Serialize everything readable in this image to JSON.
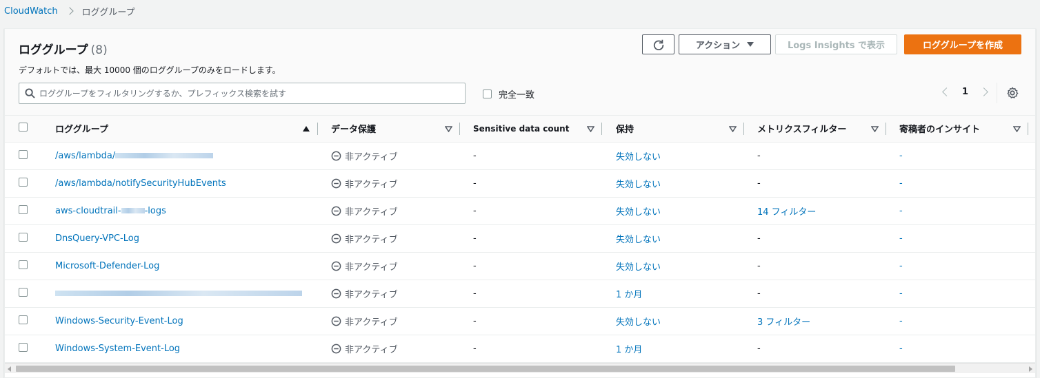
{
  "breadcrumb": {
    "root": "CloudWatch",
    "current": "ロググループ"
  },
  "header": {
    "title": "ロググループ",
    "count": "(8)",
    "description": "デフォルトでは、最大 10000 個のロググループのみをロードします。"
  },
  "toolbar": {
    "refresh_icon": "refresh-icon",
    "action_label": "アクション",
    "insights_label": "Logs Insights で表示",
    "create_label": "ロググループを作成"
  },
  "search": {
    "placeholder": "ロググループをフィルタリングするか、プレフィックス検索を試す",
    "value": ""
  },
  "exact_match_label": "完全一致",
  "pagination": {
    "current_page": "1"
  },
  "columns": {
    "log_group": "ロググループ",
    "data_protection": "データ保護",
    "sensitive_count": "Sensitive data count",
    "retention": "保持",
    "metric_filter": "メトリクスフィルター",
    "contributor_insights": "寄稿者のインサイト"
  },
  "rows": [
    {
      "name": "/aws/lambda/",
      "redacted": true,
      "protection": "非アクティブ",
      "sensitive": "-",
      "retention": "失効しない",
      "metric": "-",
      "metric_link": false,
      "insights": "-"
    },
    {
      "name": "/aws/lambda/notifySecurityHubEvents",
      "redacted": false,
      "protection": "非アクティブ",
      "sensitive": "-",
      "retention": "失効しない",
      "metric": "-",
      "metric_link": false,
      "insights": "-"
    },
    {
      "name": "aws-cloudtrail-",
      "suffix": "-logs",
      "redacted": true,
      "protection": "非アクティブ",
      "sensitive": "-",
      "retention": "失効しない",
      "metric": "14 フィルター",
      "metric_link": true,
      "insights": "-"
    },
    {
      "name": "DnsQuery-VPC-Log",
      "redacted": false,
      "protection": "非アクティブ",
      "sensitive": "-",
      "retention": "失効しない",
      "metric": "-",
      "metric_link": false,
      "insights": "-"
    },
    {
      "name": "Microsoft-Defender-Log",
      "redacted": false,
      "protection": "非アクティブ",
      "sensitive": "-",
      "retention": "失効しない",
      "metric": "-",
      "metric_link": false,
      "insights": "-"
    },
    {
      "name": "",
      "redacted": true,
      "protection": "非アクティブ",
      "sensitive": "-",
      "retention": "1 か月",
      "metric": "-",
      "metric_link": false,
      "insights": "-"
    },
    {
      "name": "Windows-Security-Event-Log",
      "redacted": false,
      "protection": "非アクティブ",
      "sensitive": "-",
      "retention": "失効しない",
      "metric": "3 フィルター",
      "metric_link": true,
      "insights": "-"
    },
    {
      "name": "Windows-System-Event-Log",
      "redacted": false,
      "protection": "非アクティブ",
      "sensitive": "-",
      "retention": "1 か月",
      "metric": "-",
      "metric_link": false,
      "insights": "-"
    }
  ],
  "colors": {
    "link": "#0073bb",
    "primary": "#ec7211",
    "border": "#eaeded"
  }
}
